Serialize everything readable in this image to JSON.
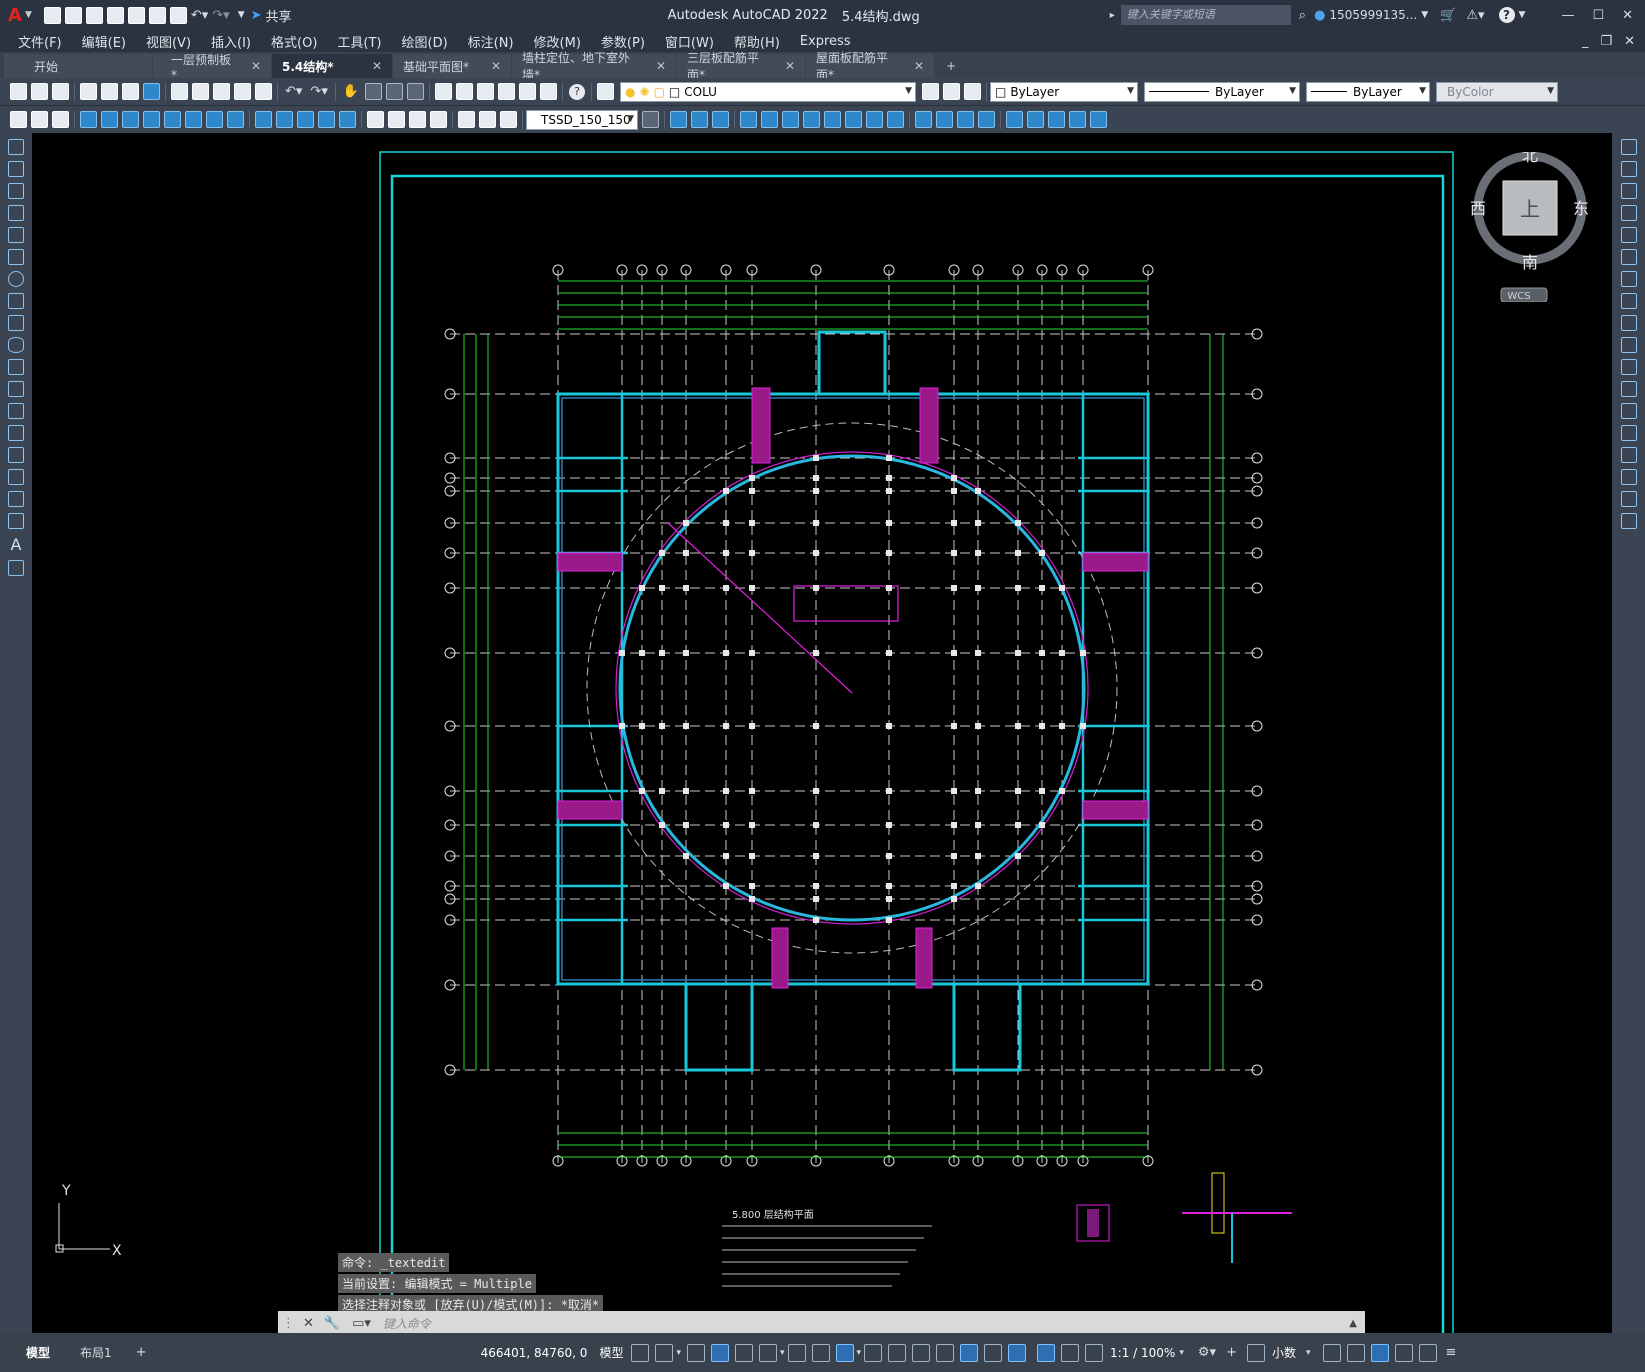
{
  "app": {
    "logo": "A",
    "title": "Autodesk AutoCAD 2022",
    "filename": "5.4结构.dwg",
    "share_label": "共享",
    "search_placeholder": "键入关键字或短语",
    "user": "1505999135...",
    "window_buttons": [
      "—",
      "☐",
      "✕"
    ]
  },
  "menu": [
    "文件(F)",
    "编辑(E)",
    "视图(V)",
    "插入(I)",
    "格式(O)",
    "工具(T)",
    "绘图(D)",
    "标注(N)",
    "修改(M)",
    "参数(P)",
    "窗口(W)",
    "帮助(H)",
    "Express"
  ],
  "tabs": [
    {
      "label": "开始",
      "active": false,
      "closable": false
    },
    {
      "label": "一层预制板*",
      "active": false,
      "closable": true
    },
    {
      "label": "5.4结构*",
      "active": true,
      "closable": true
    },
    {
      "label": "基础平面图*",
      "active": false,
      "closable": true
    },
    {
      "label": "墙柱定位、地下室外墙*",
      "active": false,
      "closable": true
    },
    {
      "label": "三层板配筋平面*",
      "active": false,
      "closable": true
    },
    {
      "label": "屋面板配筋平面*",
      "active": false,
      "closable": true
    }
  ],
  "tab_add": "+",
  "properties": {
    "layer": "COLU",
    "color": "ByLayer",
    "linetype": "ByLayer",
    "lineweight": "ByLayer",
    "plotstyle": "ByColor",
    "textstyle": "TSSD_150_150"
  },
  "viewcube": {
    "north": "北",
    "south": "南",
    "east": "东",
    "west": "西",
    "top": "上",
    "wcs": "WCS"
  },
  "ucs": {
    "x": "X",
    "y": "Y"
  },
  "drawing": {
    "plan_title": "5.800 层结构平面",
    "axes_top": [
      "1",
      "2",
      "3",
      "4",
      "5",
      "6",
      "7",
      "8",
      "9",
      "10",
      "11",
      "12",
      "13",
      "14",
      "15",
      "16",
      "17",
      "18"
    ],
    "axes_side": [
      "M",
      "L",
      "K",
      "J",
      "H",
      "G",
      "F",
      "E",
      "D",
      "C",
      "B",
      "A"
    ]
  },
  "command": {
    "history": [
      "命令: _textedit",
      "当前设置: 编辑模式 = Multiple",
      "选择注释对象或 [放弃(U)/模式(M)]: *取消*"
    ],
    "placeholder": "键入命令"
  },
  "status": {
    "tabs": [
      "模型",
      "布局1"
    ],
    "add": "+",
    "coords": "466401, 84760, 0",
    "model": "模型",
    "scale": "1:1 / 100%",
    "units": "小数"
  }
}
